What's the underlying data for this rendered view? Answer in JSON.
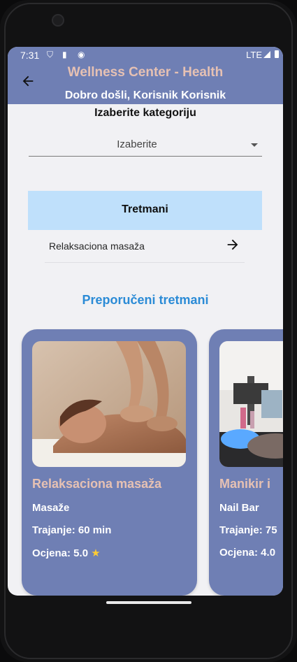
{
  "status": {
    "time": "7:31",
    "network": "LTE"
  },
  "appbar": {
    "title": "Wellness Center - Health",
    "welcome": "Dobro došli, Korisnik Korisnik"
  },
  "category": {
    "label": "Izaberite kategoriju",
    "placeholder": "Izaberite"
  },
  "treatments": {
    "section_label": "Tretmani",
    "items": [
      {
        "label": "Relaksaciona masaža"
      }
    ]
  },
  "recommended": {
    "title": "Preporučeni tretmani",
    "cards": [
      {
        "name": "Relaksaciona masaža",
        "category": "Masaže",
        "duration": "Trajanje: 60 min",
        "rating": "Ocjena: 5.0",
        "rating_icon": "star-icon"
      },
      {
        "name": "Manikir i",
        "category": "Nail Bar",
        "duration": "Trajanje: 75",
        "rating": "Ocjena: 4.0",
        "rating_icon": ""
      }
    ]
  },
  "colors": {
    "appbar": "#6f7fb4",
    "title": "#e6c1b3",
    "accent": "#2b8bd6",
    "section_bg": "#bfe0fb"
  }
}
